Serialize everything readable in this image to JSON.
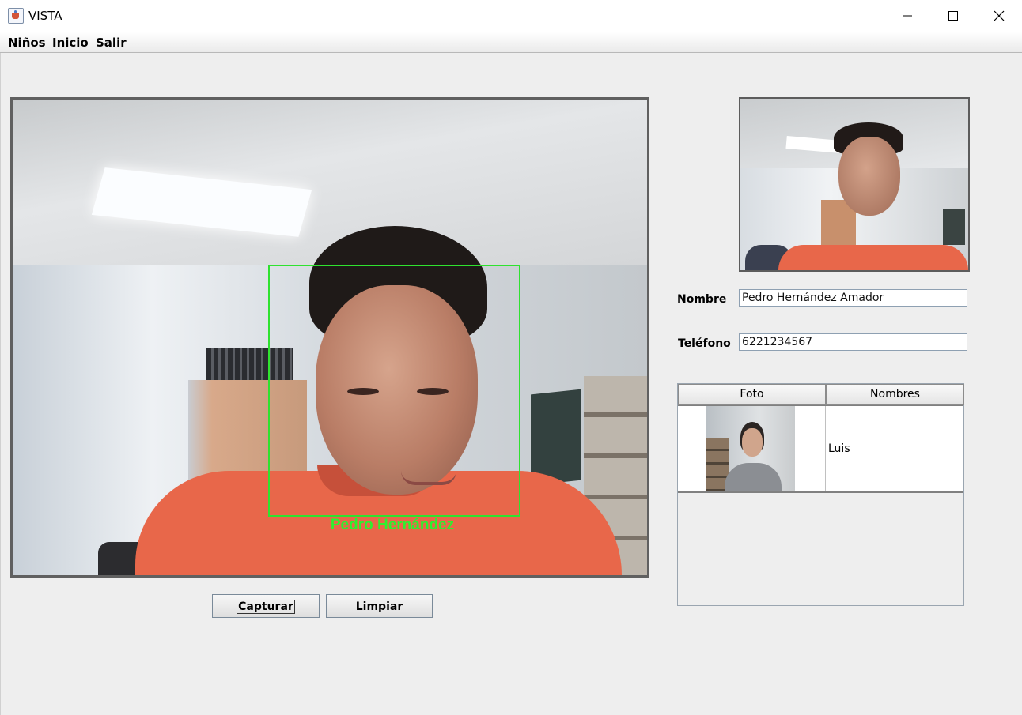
{
  "window": {
    "title": "VISTA",
    "controls": [
      "minimize",
      "maximize",
      "close"
    ]
  },
  "menubar": {
    "items": [
      "Niños",
      "Inicio",
      "Salir"
    ]
  },
  "camera": {
    "recognized_name": "Pedro Hernández",
    "box_color": "#2fe22f"
  },
  "buttons": {
    "capture": "Capturar",
    "clear": "Limpiar"
  },
  "form": {
    "name_label": "Nombre",
    "name_value": "Pedro Hernández Amador",
    "phone_label": "Teléfono",
    "phone_value": "6221234567"
  },
  "table": {
    "headers": [
      "Foto",
      "Nombres"
    ],
    "rows": [
      {
        "photo": "person-thumbnail",
        "name": "Luis"
      }
    ]
  }
}
